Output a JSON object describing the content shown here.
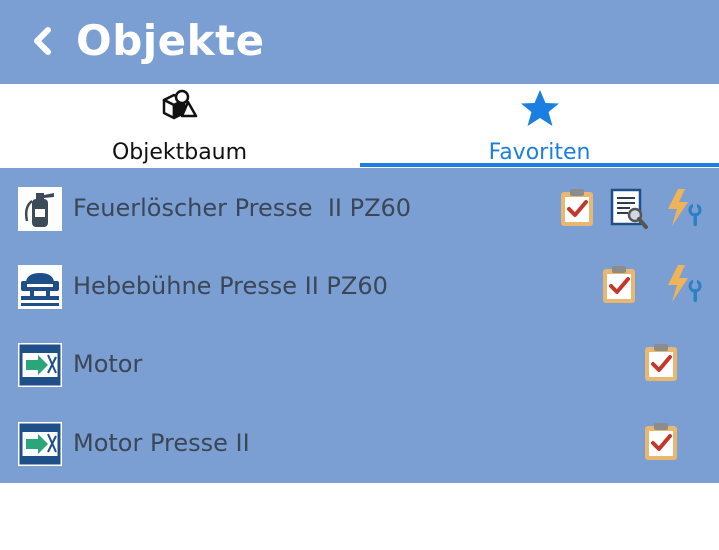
{
  "header": {
    "title": "Objekte"
  },
  "tabs": [
    {
      "label": "Objektbaum",
      "icon": "shapes-icon"
    },
    {
      "label": "Favoriten",
      "icon": "star-icon"
    }
  ],
  "items": [
    {
      "label": "Feuerlöscher Presse  II PZ60",
      "thumb": "fire-extinguisher-icon"
    },
    {
      "label": "Hebebühne Presse II PZ60",
      "thumb": "lift-platform-icon"
    },
    {
      "label": "Motor",
      "thumb": "motor-icon"
    },
    {
      "label": "Motor Presse II",
      "thumb": "motor-icon"
    }
  ],
  "colors": {
    "header_bg": "#7b9fd3",
    "accent": "#1a7fe0",
    "clipboard": "#e8b870",
    "check": "#c0392b"
  }
}
